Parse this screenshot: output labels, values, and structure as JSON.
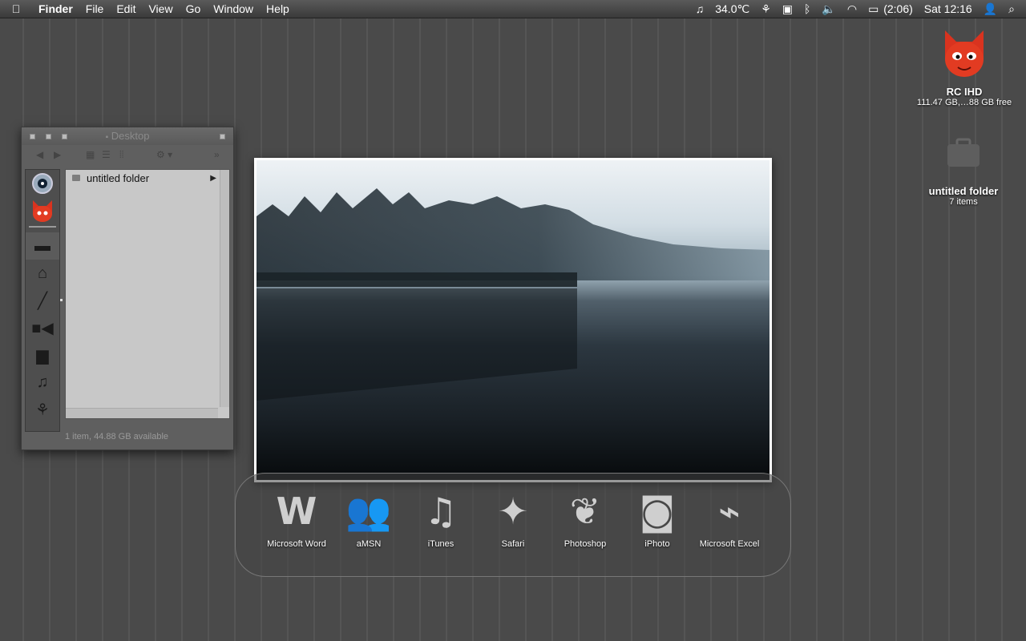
{
  "menubar": {
    "apple": "",
    "app_name": "Finder",
    "items": [
      "File",
      "Edit",
      "View",
      "Go",
      "Window",
      "Help"
    ],
    "status": {
      "music": "♫",
      "temperature": "34.0℃",
      "battery": "(2:06)",
      "clock": "Sat 12:16"
    }
  },
  "desktop_icons": [
    {
      "label": "RC IHD",
      "sub": "111.47 GB,…88 GB free"
    },
    {
      "label": "untitled folder",
      "sub": "7 items"
    }
  ],
  "finder": {
    "title": "Desktop",
    "rows": [
      {
        "name": "untitled folder"
      }
    ],
    "status": "1 item, 44.88 GB available"
  },
  "dock": {
    "items": [
      {
        "label": "Microsoft Word",
        "glyph": "W"
      },
      {
        "label": "aMSN",
        "glyph": "👥"
      },
      {
        "label": "iTunes",
        "glyph": "♫"
      },
      {
        "label": "Safari",
        "glyph": "✦"
      },
      {
        "label": "Photoshop",
        "glyph": "❦"
      },
      {
        "label": "iPhoto",
        "glyph": "◙"
      },
      {
        "label": "Microsoft Excel",
        "glyph": "⌁"
      }
    ]
  }
}
